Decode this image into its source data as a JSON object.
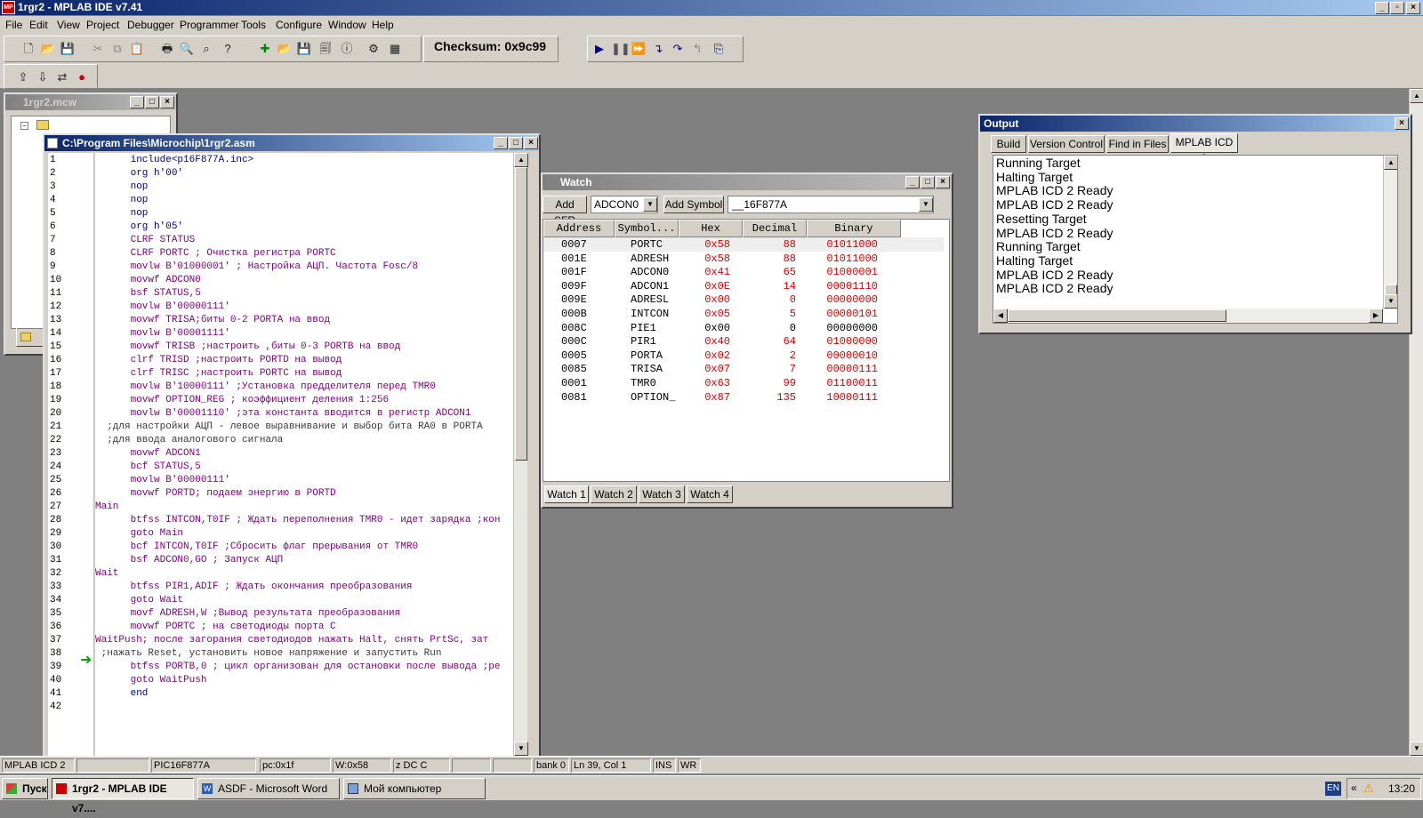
{
  "app": {
    "title": "1rgr2 - MPLAB IDE v7.41"
  },
  "menu": [
    "File",
    "Edit",
    "View",
    "Project",
    "Debugger",
    "Programmer",
    "Tools",
    "Configure",
    "Window",
    "Help"
  ],
  "toolbar": {
    "checksum": "Checksum:  0x9c99"
  },
  "workspace": {
    "title": "1rgr2.mcw"
  },
  "editor": {
    "title": "C:\\Program Files\\Microchip\\1rgr2.asm",
    "lines": [
      "      include<p16F877A.inc>",
      "      org h'00'",
      "      nop",
      "      nop",
      "      nop",
      "      org h'05'",
      "      CLRF STATUS",
      "      CLRF PORTC ; Очистка регистра PORTC",
      "      movlw B'01000001' ; Настройка АЦП. Частота Fosc/8",
      "      movwf ADCON0",
      "      bsf STATUS,5",
      "      movlw B'00000111'",
      "      movwf TRISA;биты 0-2 PORTA на ввод",
      "      movlw B'00001111'",
      "      movwf TRISB ;настроить ,биты 0-3 PORTB на ввод",
      "      clrf TRISD ;настроить PORTD на вывод",
      "      clrf TRISC ;настроить PORTC на вывод",
      "      movlw B'10000111' ;Установка предделителя перед TMR0",
      "      movwf OPTION_REG ; коэффициент деления 1:256",
      "      movlw B'00001110' ;эта константа вводится в регистр ADCON1",
      "  ;для настройки АЦП - левое выравнивание и выбор бита RA0 в PORTA",
      "  ;для ввода аналогового сигнала",
      "      movwf ADCON1",
      "      bcf STATUS,5",
      "      movlw B'00000111'",
      "      movwf PORTD; подаем энергию в PORTD",
      "Main",
      "      btfss INTCON,T0IF ; Ждать переполнения TMR0 - идет зарядка ;кон",
      "      goto Main",
      "      bcf INTCON,T0IF ;Сбросить флаг прерывания от TMR0",
      "      bsf ADCON0,GO ; Запуск АЦП",
      "Wait",
      "      btfss PIR1,ADIF ; Ждать окончания преобразования",
      "      goto Wait",
      "      movf ADRESH,W ;Вывод результата преобразования",
      "      movwf PORTC ; на светодиоды порта С",
      "WaitPush; после загорания светодиодов нажать Halt, снять PrtSc, зат",
      " ;нажать Reset, установить новое напряжение и запустить Run",
      "      btfss PORTB,0 ; цикл организован для остановки после вывода ;ре",
      "      goto WaitPush",
      "      end",
      ""
    ]
  },
  "watch": {
    "title": "Watch",
    "add_sfr": "Add SFR",
    "sfr_select": "ADCON0",
    "add_symbol": "Add Symbol",
    "symbol_select": "__16F877A",
    "headers": [
      "Address",
      "Symbol...",
      "Hex",
      "Decimal",
      "Binary"
    ],
    "rows": [
      [
        "0007",
        "PORTC",
        "0x58",
        "88",
        "01011000"
      ],
      [
        "001E",
        "ADRESH",
        "0x58",
        "88",
        "01011000"
      ],
      [
        "001F",
        "ADCON0",
        "0x41",
        "65",
        "01000001"
      ],
      [
        "009F",
        "ADCON1",
        "0x0E",
        "14",
        "00001110"
      ],
      [
        "009E",
        "ADRESL",
        "0x00",
        "0",
        "00000000"
      ],
      [
        "000B",
        "INTCON",
        "0x05",
        "5",
        "00000101"
      ],
      [
        "008C",
        "PIE1",
        "0x00",
        "0",
        "00000000"
      ],
      [
        "000C",
        "PIR1",
        "0x40",
        "64",
        "01000000"
      ],
      [
        "0005",
        "PORTA",
        "0x02",
        "2",
        "00000010"
      ],
      [
        "0085",
        "TRISA",
        "0x07",
        "7",
        "00000111"
      ],
      [
        "0001",
        "TMR0",
        "0x63",
        "99",
        "01100011"
      ],
      [
        "0081",
        "OPTION_",
        "0x87",
        "135",
        "10000111"
      ]
    ],
    "changed": [
      true,
      true,
      true,
      true,
      true,
      true,
      false,
      true,
      true,
      true,
      true,
      true
    ],
    "tabs": [
      "Watch 1",
      "Watch 2",
      "Watch 3",
      "Watch 4"
    ]
  },
  "output": {
    "title": "Output",
    "tabs": [
      "Build",
      "Version Control",
      "Find in Files",
      "MPLAB ICD 2"
    ],
    "lines": [
      "Running Target",
      "Halting Target",
      "MPLAB ICD 2 Ready",
      "MPLAB ICD 2 Ready",
      "Resetting Target",
      "MPLAB ICD 2 Ready",
      "Running Target",
      "Halting Target",
      "MPLAB ICD 2 Ready",
      "MPLAB ICD 2 Ready"
    ]
  },
  "statusbar": {
    "debugger": "MPLAB ICD 2",
    "device": "PIC16F877A",
    "pc": "pc:0x1f",
    "w": "W:0x58",
    "flags": "z DC C",
    "bank": "bank 0",
    "pos": "Ln 39, Col 1",
    "ins": "INS",
    "wr": "WR"
  },
  "taskbar": {
    "start": "Пуск",
    "tasks": [
      "1rgr2 - MPLAB IDE v7....",
      "ASDF - Microsoft Word",
      "Мой компьютер"
    ],
    "lang": "EN",
    "clock": "13:20"
  },
  "colors": {
    "title_active": "#0a246a",
    "changed_value": "#e00000",
    "face": "#d4d0c8"
  }
}
